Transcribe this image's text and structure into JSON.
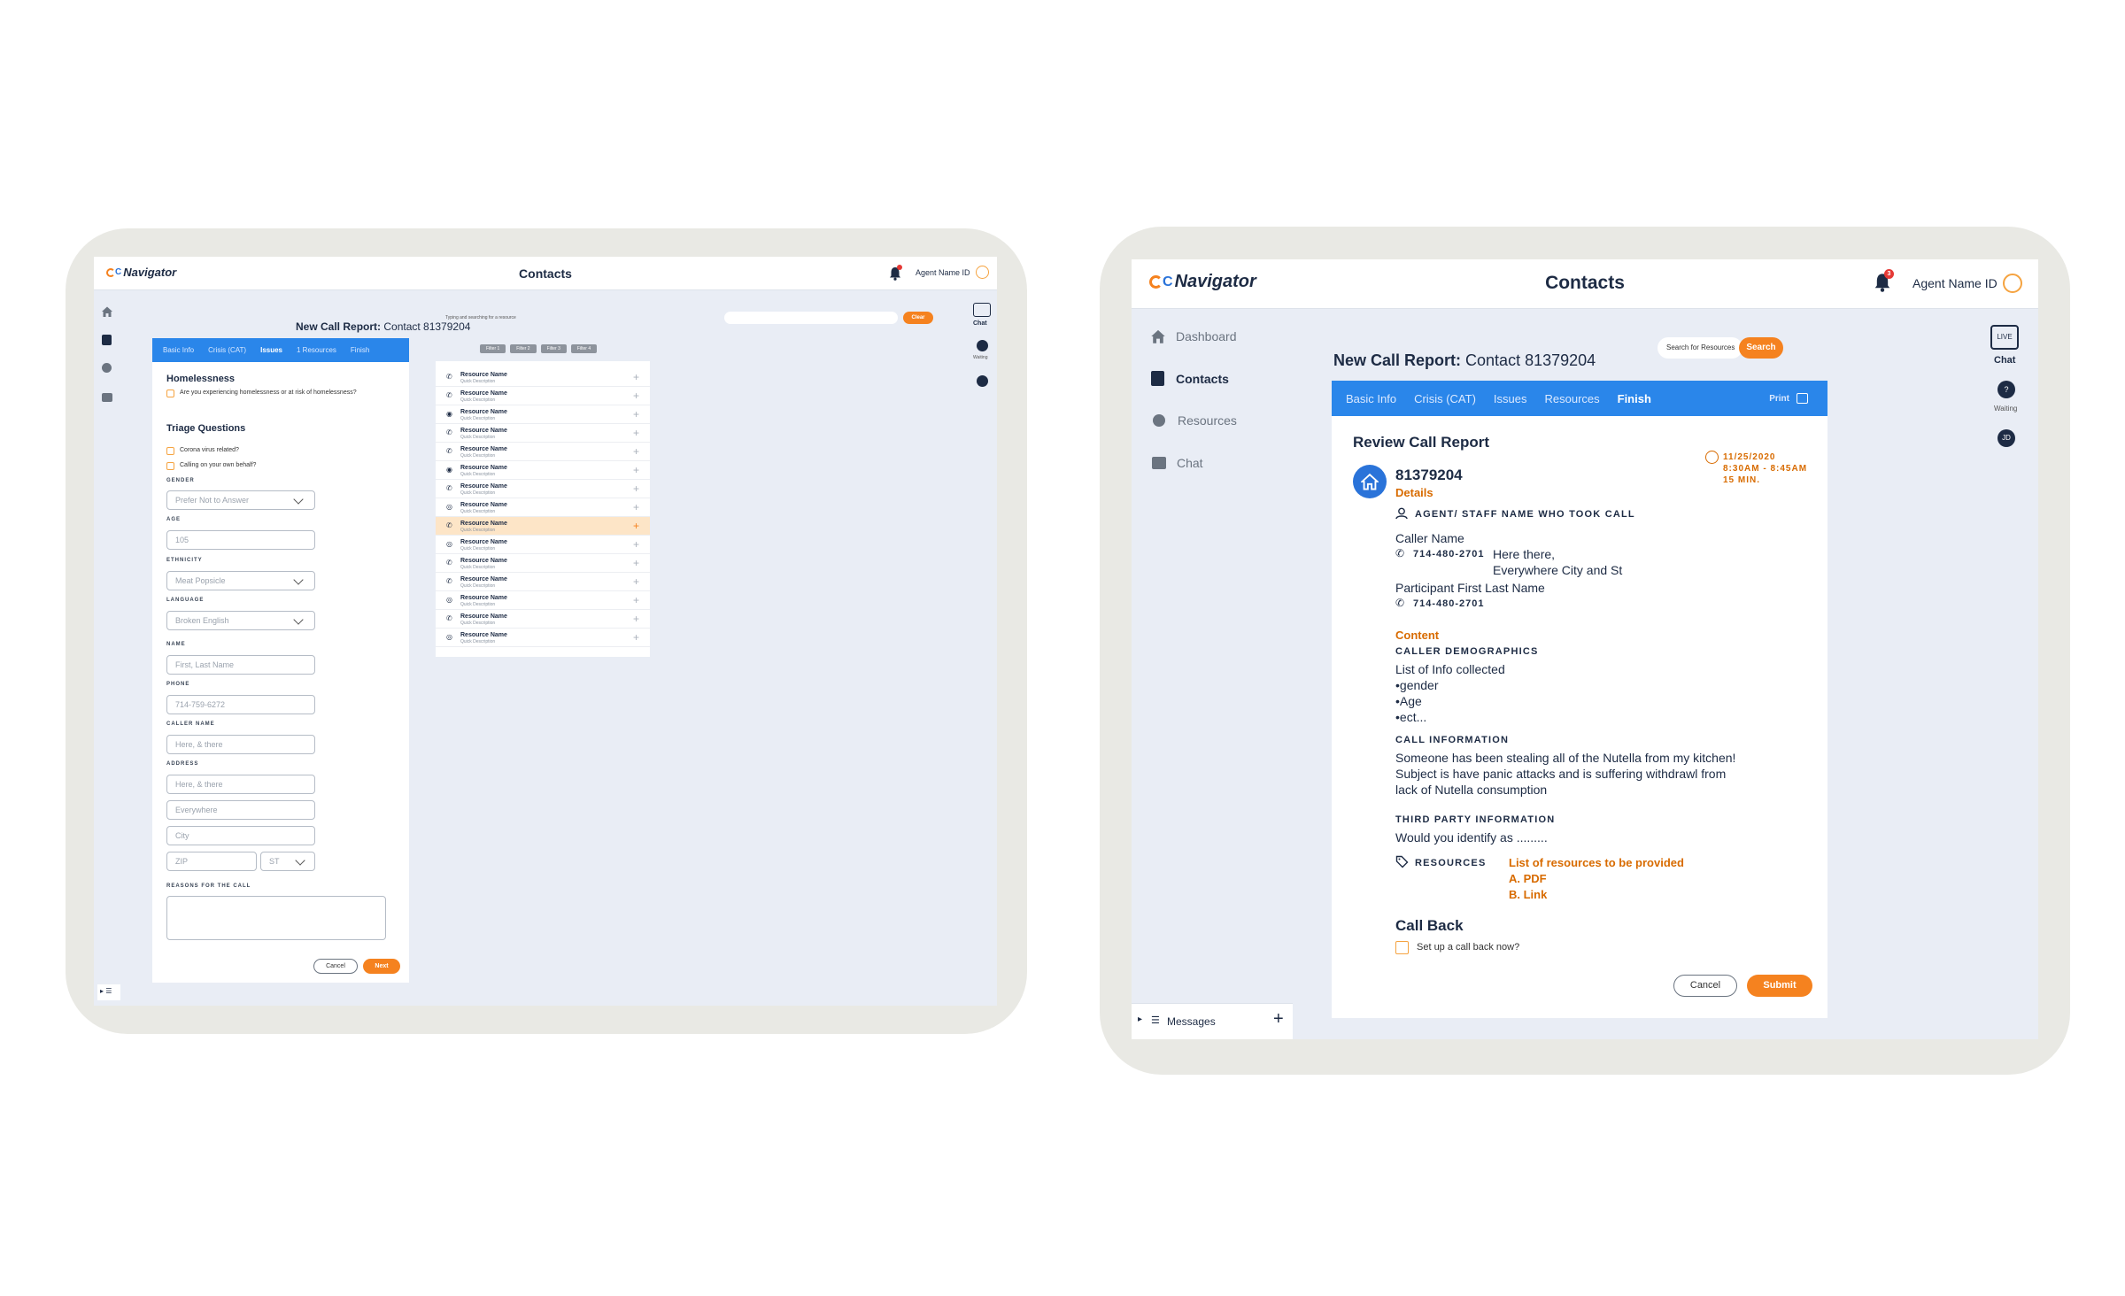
{
  "left": {
    "app_logo": "Navigator",
    "page_title": "Contacts",
    "agent": "Agent Name ID",
    "bell_count": "",
    "chat_label": "Chat",
    "waiting_label": "Waiting",
    "report_title_bold": "New Call Report:",
    "report_title_rest": " Contact 81379204",
    "typing_hint": "Typing and searching for a resource",
    "clear_btn": "Clear",
    "tabs": [
      "Basic Info",
      "Crisis (CAT)",
      "Issues",
      "1 Resources",
      "Finish"
    ],
    "filters": [
      "Filter 1",
      "Filter 2",
      "Filter 3",
      "Filter 4"
    ],
    "homelessness_title": "Homelessness",
    "homelessness_q": "Are you experiencing homelessness or at risk of homelessness?",
    "triage_title": "Triage Questions",
    "triage_q1": "Corona virus related?",
    "triage_q2": "Calling on your own behalf?",
    "gender_label": "GENDER",
    "gender_value": "Prefer Not to Answer",
    "age_label": "AGE",
    "age_value": "105",
    "ethnicity_label": "ETHNICITY",
    "ethnicity_value": "Meat Popsicle",
    "language_label": "LANGUAGE",
    "language_value": "Broken English",
    "name_label": "NAME",
    "name_placeholder": "First, Last Name",
    "phone_label": "PHONE",
    "phone_value": "714-759-6272",
    "caller_label": "CALLER NAME",
    "caller_value": "Here, & there",
    "address_label": "ADDRESS",
    "address1": "Here, & there",
    "address2": "Everywhere",
    "city": "City",
    "zip": "ZIP",
    "st": "ST",
    "reasons_label": "REASONS FOR THE CALL",
    "cancel": "Cancel",
    "next": "Next",
    "resources": [
      {
        "name": "Resource Name",
        "desc": "Quick Description",
        "icon": "phone"
      },
      {
        "name": "Resource Name",
        "desc": "Quick Description",
        "icon": "phone"
      },
      {
        "name": "Resource Name",
        "desc": "Quick Description",
        "icon": "pin"
      },
      {
        "name": "Resource Name",
        "desc": "Quick Description",
        "icon": "phone"
      },
      {
        "name": "Resource Name",
        "desc": "Quick Description",
        "icon": "phone"
      },
      {
        "name": "Resource Name",
        "desc": "Quick Description",
        "icon": "pin"
      },
      {
        "name": "Resource Name",
        "desc": "Quick Description",
        "icon": "phone"
      },
      {
        "name": "Resource Name",
        "desc": "Quick Description",
        "icon": "globe"
      },
      {
        "name": "Resource Name",
        "desc": "Quick Description",
        "icon": "phone"
      },
      {
        "name": "Resource Name",
        "desc": "Quick Description",
        "icon": "globe"
      },
      {
        "name": "Resource Name",
        "desc": "Quick Description",
        "icon": "phone"
      },
      {
        "name": "Resource Name",
        "desc": "Quick Description",
        "icon": "phone"
      },
      {
        "name": "Resource Name",
        "desc": "Quick Description",
        "icon": "globe"
      },
      {
        "name": "Resource Name",
        "desc": "Quick Description",
        "icon": "phone"
      },
      {
        "name": "Resource Name",
        "desc": "Quick Description",
        "icon": "globe"
      }
    ],
    "highlighted_row": 8
  },
  "right": {
    "app_logo": "Navigator",
    "page_title": "Contacts",
    "agent": "Agent Name ID",
    "bell_count": "3",
    "sidebar": [
      "Dashboard",
      "Contacts",
      "Resources",
      "Chat"
    ],
    "messages_label": "Messages",
    "chat_label": "Chat",
    "live_label": "LIVE",
    "waiting_label": "Waiting",
    "user_initials": "JD",
    "report_title_bold": "New Call Report:",
    "report_title_rest": " Contact 81379204",
    "search_placeholder": "Search for Resources",
    "search_btn": "Search",
    "tabs": [
      "Basic Info",
      "Crisis (CAT)",
      "Issues",
      "Resources",
      "Finish"
    ],
    "print_label": "Print",
    "review_title": "Review Call Report",
    "contact_id": "81379204",
    "details": "Details",
    "date": "11/25/2020",
    "time": "8:30AM - 8:45AM",
    "duration": "15 MIN.",
    "agent_hdr": "AGENT/ STAFF NAME WHO TOOK CALL",
    "caller_name": "Caller Name",
    "caller_phone": "714-480-2701",
    "caller_addr1": "Here there,",
    "caller_addr2": "Everywhere City and St",
    "participant": "Participant First Last Name",
    "participant_phone": "714-480-2701",
    "content": "Content",
    "demographics_hdr": "CALLER DEMOGRAPHICS",
    "demo_lines": [
      "List of Info collected",
      "•gender",
      "•Age",
      "•ect..."
    ],
    "call_info_hdr": "CALL INFORMATION",
    "call_info_lines": [
      "Someone has been stealing all of the Nutella from my kitchen!",
      "Subject is have panic attacks and is suffering withdrawl from",
      "lack of Nutella consumption"
    ],
    "third_party_hdr": "THIRD PARTY INFORMATION",
    "third_party_text": "Would you identify as .........",
    "resources_hdr": "RESOURCES",
    "resources_lines": [
      "List of resources to be provided",
      "A. PDF",
      "B. Link"
    ],
    "callback_title": "Call Back",
    "callback_q": "Set up a call back now?",
    "cancel": "Cancel",
    "submit": "Submit"
  }
}
